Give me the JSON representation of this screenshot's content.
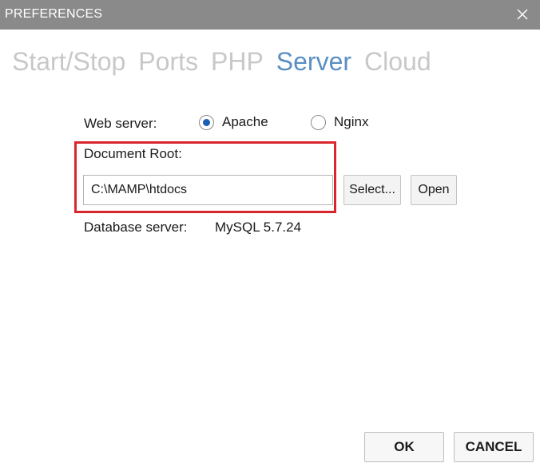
{
  "window": {
    "title": "PREFERENCES",
    "close_icon": "close-icon"
  },
  "tabs": [
    {
      "label": "Start/Stop",
      "active": false
    },
    {
      "label": "Ports",
      "active": false
    },
    {
      "label": "PHP",
      "active": false
    },
    {
      "label": "Server",
      "active": true
    },
    {
      "label": "Cloud",
      "active": false
    }
  ],
  "server": {
    "web_server_label": "Web server:",
    "options": [
      {
        "label": "Apache",
        "selected": true
      },
      {
        "label": "Nginx",
        "selected": false
      }
    ],
    "document_root_label": "Document Root:",
    "document_root_value": "C:\\MAMP\\htdocs",
    "select_button": "Select...",
    "open_button": "Open",
    "database_server_label": "Database server:",
    "database_server_value": "MySQL 5.7.24"
  },
  "footer": {
    "ok_button": "OK",
    "cancel_button": "CANCEL"
  },
  "colors": {
    "titlebar": "#8a8a8a",
    "active_tab": "#5b8fc4",
    "inactive_tab": "#c8c8c8",
    "highlight": "#d9262c",
    "radio_checked": "#1a5fb4"
  }
}
